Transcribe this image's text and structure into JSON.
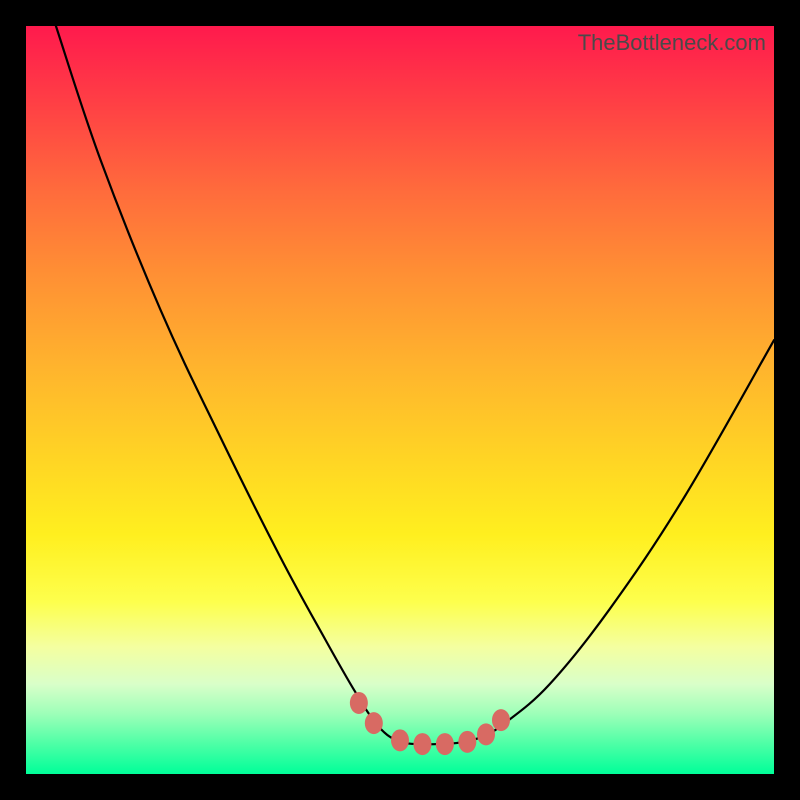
{
  "watermark": "TheBottleneck.com",
  "chart_data": {
    "type": "line",
    "title": "",
    "xlabel": "",
    "ylabel": "",
    "xlim": [
      0,
      100
    ],
    "ylim": [
      0,
      100
    ],
    "series": [
      {
        "name": "curve",
        "x": [
          4,
          10,
          18,
          26,
          34,
          40,
          44,
          47,
          49.5,
          52,
          55,
          58,
          61,
          64,
          70,
          78,
          88,
          100
        ],
        "y": [
          100,
          82,
          62,
          45,
          29,
          18,
          11,
          6.5,
          4.5,
          4,
          4,
          4.2,
          5,
          6.8,
          12,
          22,
          37,
          58
        ]
      }
    ],
    "markers": {
      "name": "highlight-points",
      "x": [
        44.5,
        46.5,
        50,
        53,
        56,
        59,
        61.5,
        63.5
      ],
      "y": [
        9.5,
        6.8,
        4.5,
        4.0,
        4.0,
        4.3,
        5.3,
        7.2
      ]
    },
    "colors": {
      "curve_stroke": "#000000",
      "marker_fill": "#d86a63",
      "gradient_top": "#ff1a4d",
      "gradient_bottom": "#00ff99"
    }
  }
}
